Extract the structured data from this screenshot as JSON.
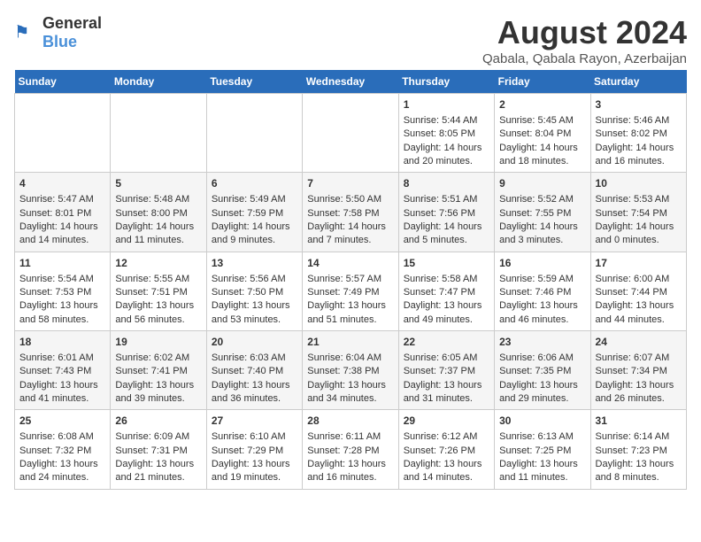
{
  "header": {
    "logo_general": "General",
    "logo_blue": "Blue",
    "main_title": "August 2024",
    "subtitle": "Qabala, Qabala Rayon, Azerbaijan"
  },
  "days_of_week": [
    "Sunday",
    "Monday",
    "Tuesday",
    "Wednesday",
    "Thursday",
    "Friday",
    "Saturday"
  ],
  "weeks": [
    [
      {
        "day": "",
        "content": ""
      },
      {
        "day": "",
        "content": ""
      },
      {
        "day": "",
        "content": ""
      },
      {
        "day": "",
        "content": ""
      },
      {
        "day": "1",
        "content": "Sunrise: 5:44 AM\nSunset: 8:05 PM\nDaylight: 14 hours and 20 minutes."
      },
      {
        "day": "2",
        "content": "Sunrise: 5:45 AM\nSunset: 8:04 PM\nDaylight: 14 hours and 18 minutes."
      },
      {
        "day": "3",
        "content": "Sunrise: 5:46 AM\nSunset: 8:02 PM\nDaylight: 14 hours and 16 minutes."
      }
    ],
    [
      {
        "day": "4",
        "content": "Sunrise: 5:47 AM\nSunset: 8:01 PM\nDaylight: 14 hours and 14 minutes."
      },
      {
        "day": "5",
        "content": "Sunrise: 5:48 AM\nSunset: 8:00 PM\nDaylight: 14 hours and 11 minutes."
      },
      {
        "day": "6",
        "content": "Sunrise: 5:49 AM\nSunset: 7:59 PM\nDaylight: 14 hours and 9 minutes."
      },
      {
        "day": "7",
        "content": "Sunrise: 5:50 AM\nSunset: 7:58 PM\nDaylight: 14 hours and 7 minutes."
      },
      {
        "day": "8",
        "content": "Sunrise: 5:51 AM\nSunset: 7:56 PM\nDaylight: 14 hours and 5 minutes."
      },
      {
        "day": "9",
        "content": "Sunrise: 5:52 AM\nSunset: 7:55 PM\nDaylight: 14 hours and 3 minutes."
      },
      {
        "day": "10",
        "content": "Sunrise: 5:53 AM\nSunset: 7:54 PM\nDaylight: 14 hours and 0 minutes."
      }
    ],
    [
      {
        "day": "11",
        "content": "Sunrise: 5:54 AM\nSunset: 7:53 PM\nDaylight: 13 hours and 58 minutes."
      },
      {
        "day": "12",
        "content": "Sunrise: 5:55 AM\nSunset: 7:51 PM\nDaylight: 13 hours and 56 minutes."
      },
      {
        "day": "13",
        "content": "Sunrise: 5:56 AM\nSunset: 7:50 PM\nDaylight: 13 hours and 53 minutes."
      },
      {
        "day": "14",
        "content": "Sunrise: 5:57 AM\nSunset: 7:49 PM\nDaylight: 13 hours and 51 minutes."
      },
      {
        "day": "15",
        "content": "Sunrise: 5:58 AM\nSunset: 7:47 PM\nDaylight: 13 hours and 49 minutes."
      },
      {
        "day": "16",
        "content": "Sunrise: 5:59 AM\nSunset: 7:46 PM\nDaylight: 13 hours and 46 minutes."
      },
      {
        "day": "17",
        "content": "Sunrise: 6:00 AM\nSunset: 7:44 PM\nDaylight: 13 hours and 44 minutes."
      }
    ],
    [
      {
        "day": "18",
        "content": "Sunrise: 6:01 AM\nSunset: 7:43 PM\nDaylight: 13 hours and 41 minutes."
      },
      {
        "day": "19",
        "content": "Sunrise: 6:02 AM\nSunset: 7:41 PM\nDaylight: 13 hours and 39 minutes."
      },
      {
        "day": "20",
        "content": "Sunrise: 6:03 AM\nSunset: 7:40 PM\nDaylight: 13 hours and 36 minutes."
      },
      {
        "day": "21",
        "content": "Sunrise: 6:04 AM\nSunset: 7:38 PM\nDaylight: 13 hours and 34 minutes."
      },
      {
        "day": "22",
        "content": "Sunrise: 6:05 AM\nSunset: 7:37 PM\nDaylight: 13 hours and 31 minutes."
      },
      {
        "day": "23",
        "content": "Sunrise: 6:06 AM\nSunset: 7:35 PM\nDaylight: 13 hours and 29 minutes."
      },
      {
        "day": "24",
        "content": "Sunrise: 6:07 AM\nSunset: 7:34 PM\nDaylight: 13 hours and 26 minutes."
      }
    ],
    [
      {
        "day": "25",
        "content": "Sunrise: 6:08 AM\nSunset: 7:32 PM\nDaylight: 13 hours and 24 minutes."
      },
      {
        "day": "26",
        "content": "Sunrise: 6:09 AM\nSunset: 7:31 PM\nDaylight: 13 hours and 21 minutes."
      },
      {
        "day": "27",
        "content": "Sunrise: 6:10 AM\nSunset: 7:29 PM\nDaylight: 13 hours and 19 minutes."
      },
      {
        "day": "28",
        "content": "Sunrise: 6:11 AM\nSunset: 7:28 PM\nDaylight: 13 hours and 16 minutes."
      },
      {
        "day": "29",
        "content": "Sunrise: 6:12 AM\nSunset: 7:26 PM\nDaylight: 13 hours and 14 minutes."
      },
      {
        "day": "30",
        "content": "Sunrise: 6:13 AM\nSunset: 7:25 PM\nDaylight: 13 hours and 11 minutes."
      },
      {
        "day": "31",
        "content": "Sunrise: 6:14 AM\nSunset: 7:23 PM\nDaylight: 13 hours and 8 minutes."
      }
    ]
  ]
}
